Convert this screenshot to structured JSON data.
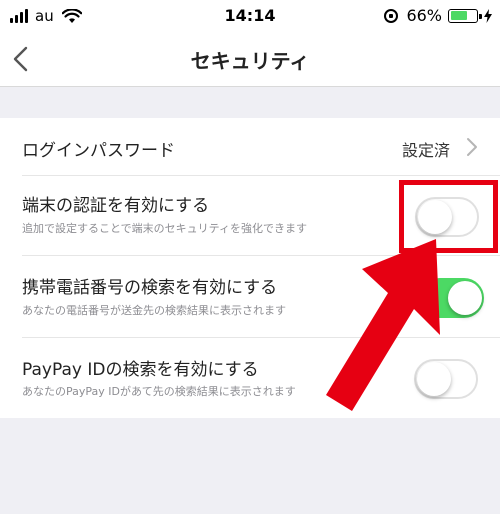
{
  "status_bar": {
    "carrier": "au",
    "time": "14:14",
    "battery_percent": "66%",
    "battery_level": 0.66,
    "icons": [
      "signal-bars-icon",
      "wifi-icon",
      "rotation-lock-icon",
      "battery-icon",
      "charging-bolt-icon"
    ]
  },
  "nav": {
    "title": "セキュリティ",
    "back_icon": "chevron-left-icon"
  },
  "settings": {
    "login_password": {
      "label": "ログインパスワード",
      "value": "設定済"
    },
    "device_auth": {
      "label": "端末の認証を有効にする",
      "description": "追加で設定することで端末のセキュリティを強化できます",
      "enabled": false
    },
    "phone_search": {
      "label": "携帯電話番号の検索を有効にする",
      "description": "あなたの電話番号が送金先の検索結果に表示されます",
      "enabled": true
    },
    "paypay_id_search": {
      "label": "PayPay IDの検索を有効にする",
      "description": "あなたのPayPay IDがあて先の検索結果に表示されます",
      "enabled": false
    }
  },
  "annotation": {
    "highlight_color": "#e60012",
    "arrow_color": "#e60012"
  },
  "colors": {
    "toggle_on": "#4cd964",
    "background": "#efeff4"
  }
}
